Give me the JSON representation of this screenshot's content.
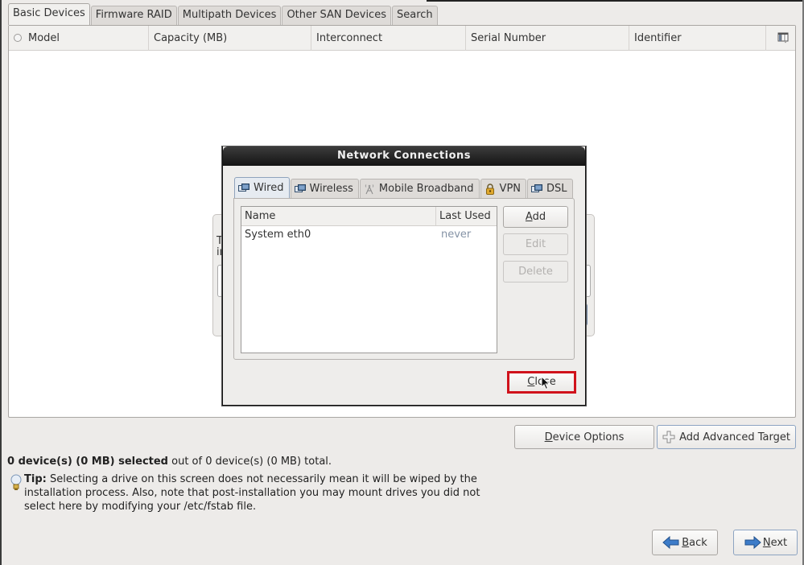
{
  "main_tabs": [
    {
      "label": "Basic Devices",
      "active": true
    },
    {
      "label": "Firmware RAID",
      "active": false
    },
    {
      "label": "Multipath Devices",
      "active": false
    },
    {
      "label": "Other SAN Devices",
      "active": false
    },
    {
      "label": "Search",
      "active": false
    }
  ],
  "device_table": {
    "columns": [
      "Model",
      "Capacity (MB)",
      "Interconnect",
      "Serial Number",
      "Identifier"
    ],
    "rows": [],
    "column_chooser_icon": "column-chooser-icon"
  },
  "background_dialog": {
    "text_fragment_line1": "T",
    "text_fragment_line2": "in"
  },
  "network_dialog": {
    "title": "Network Connections",
    "tabs": [
      {
        "label": "Wired",
        "icon": "wired-network-icon",
        "active": true
      },
      {
        "label": "Wireless",
        "icon": "wireless-network-icon",
        "active": false
      },
      {
        "label": "Mobile Broadband",
        "icon": "antenna-icon",
        "active": false
      },
      {
        "label": "VPN",
        "icon": "lock-icon",
        "active": false
      },
      {
        "label": "DSL",
        "icon": "dsl-network-icon",
        "active": false
      }
    ],
    "list": {
      "columns": [
        "Name",
        "Last Used"
      ],
      "rows": [
        {
          "name": "System eth0",
          "last_used": "never"
        }
      ]
    },
    "buttons": {
      "add": {
        "mnemonic": "A",
        "rest": "dd",
        "enabled": true
      },
      "edit": {
        "label": "Edit",
        "enabled": false
      },
      "delete": {
        "label": "Delete",
        "enabled": false
      },
      "close": {
        "mnemonic": "C",
        "rest": "lose",
        "highlighted": true
      }
    }
  },
  "actions": {
    "device_options": {
      "mnemonic": "D",
      "rest": "evice Options"
    },
    "add_advanced_target": {
      "label": "Add Advanced Target",
      "icon": "plus-icon"
    }
  },
  "summary": {
    "bold": "0 device(s) (0 MB) selected",
    "rest": " out of 0 device(s) (0 MB) total."
  },
  "tip": {
    "label": "Tip:",
    "text": " Selecting a drive on this screen does not necessarily mean it will be wiped by the installation process.  Also, note that post-installation you may mount drives you did not select here by modifying your /etc/fstab file."
  },
  "nav": {
    "back": {
      "mnemonic": "B",
      "rest": "ack"
    },
    "next": {
      "mnemonic": "N",
      "rest": "ext"
    }
  },
  "colors": {
    "highlight_border": "#d0121b",
    "arrow_blue": "#3d7cc9",
    "muted_text": "#8593a6"
  }
}
